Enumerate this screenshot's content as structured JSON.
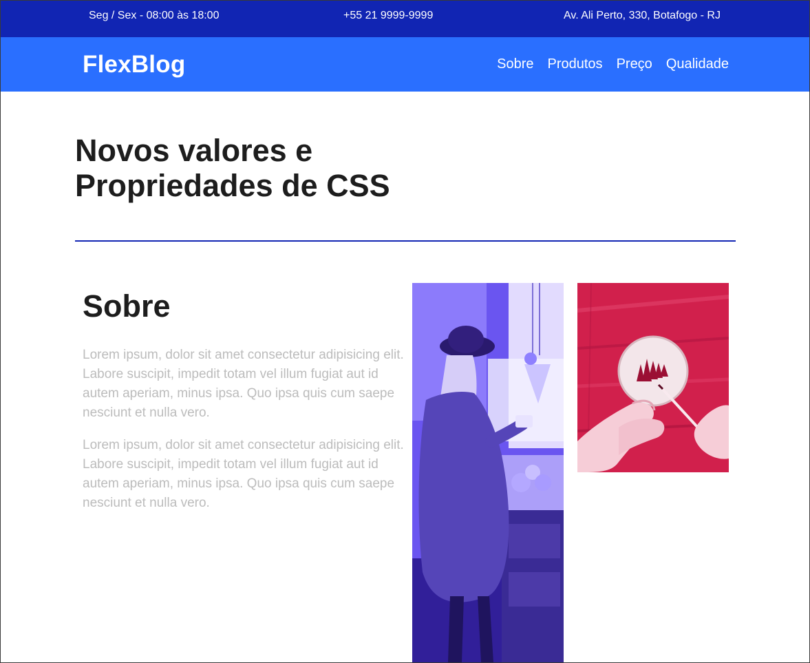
{
  "topbar": {
    "hours": "Seg / Sex - 08:00 às 18:00",
    "phone": "+55 21 9999-9999",
    "address": "Av. Ali Perto, 330, Botafogo - RJ"
  },
  "navbar": {
    "logo": "FlexBlog",
    "links": [
      "Sobre",
      "Produtos",
      "Preço",
      "Qualidade"
    ]
  },
  "main": {
    "headline": "Novos valores e Propriedades de CSS",
    "about_title": "Sobre",
    "paragraphs": [
      "Lorem ipsum, dolor sit amet consectetur adipisicing elit. Labore suscipit, impedit totam vel illum fugiat aut id autem aperiam, minus ipsa. Quo ipsa quis cum saepe nesciunt et nulla vero.",
      "Lorem ipsum, dolor sit amet consectetur adipisicing elit. Labore suscipit, impedit totam vel illum fugiat aut id autem aperiam, minus ipsa. Quo ipsa quis cum saepe nesciunt et nulla vero."
    ]
  },
  "colors": {
    "topbar": "#1125b3",
    "navbar": "#2a6fff",
    "rule": "#1125b3",
    "body_text": "#bcbcbc",
    "heading": "#1d1d1d"
  }
}
